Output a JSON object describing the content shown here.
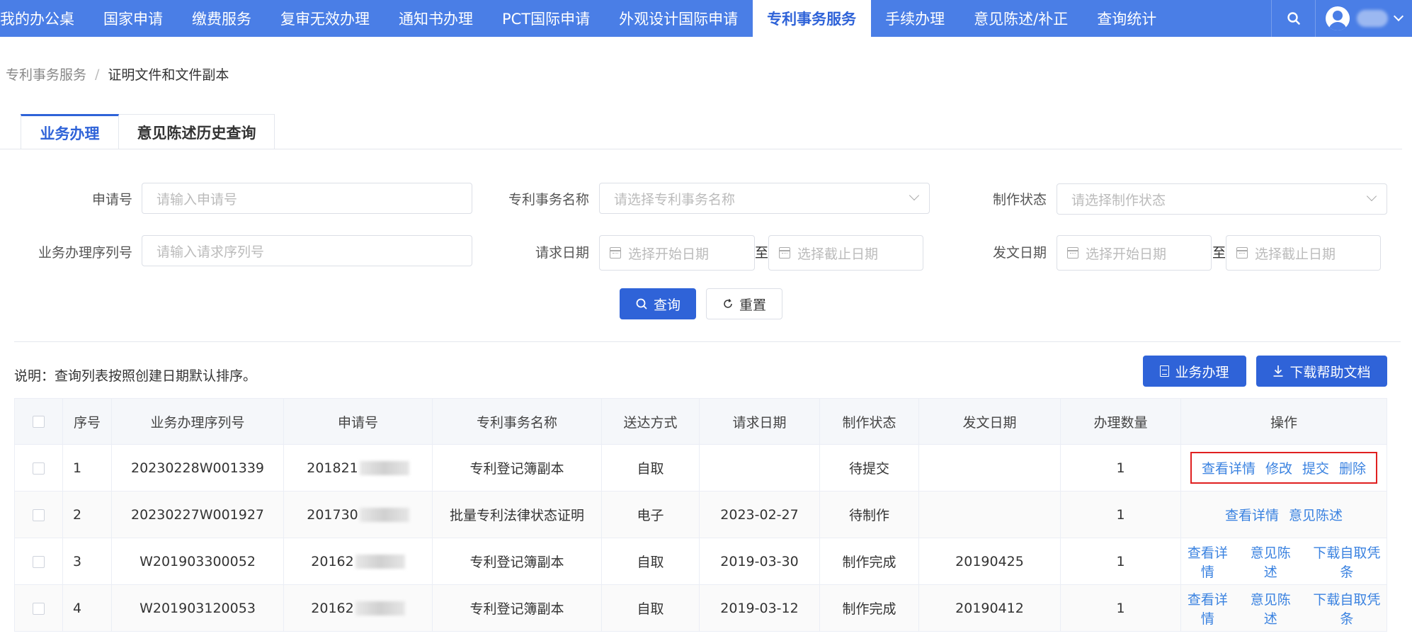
{
  "nav": {
    "items": [
      {
        "label": "我的办公桌",
        "active": false
      },
      {
        "label": "国家申请",
        "active": false
      },
      {
        "label": "缴费服务",
        "active": false
      },
      {
        "label": "复审无效办理",
        "active": false
      },
      {
        "label": "通知书办理",
        "active": false
      },
      {
        "label": "PCT国际申请",
        "active": false
      },
      {
        "label": "外观设计国际申请",
        "active": false
      },
      {
        "label": "专利事务服务",
        "active": true
      },
      {
        "label": "手续办理",
        "active": false
      },
      {
        "label": "意见陈述/补正",
        "active": false
      },
      {
        "label": "查询统计",
        "active": false
      }
    ]
  },
  "breadcrumb": {
    "parent": "专利事务服务",
    "separator": "/",
    "current": "证明文件和文件副本"
  },
  "tabs": [
    {
      "label": "业务办理",
      "active": true
    },
    {
      "label": "意见陈述历史查询",
      "active": false
    }
  ],
  "form": {
    "application_no": {
      "label": "申请号",
      "placeholder": "请输入申请号"
    },
    "affair_name": {
      "label": "专利事务名称",
      "placeholder": "请选择专利事务名称"
    },
    "status": {
      "label": "制作状态",
      "placeholder": "请选择制作状态"
    },
    "serial_no": {
      "label": "业务办理序列号",
      "placeholder": "请输入请求序列号"
    },
    "request_date": {
      "label": "请求日期",
      "start_placeholder": "选择开始日期",
      "end_placeholder": "选择截止日期",
      "to": "至"
    },
    "issue_date": {
      "label": "发文日期",
      "start_placeholder": "选择开始日期",
      "end_placeholder": "选择截止日期",
      "to": "至"
    },
    "query_label": "查询",
    "reset_label": "重置"
  },
  "note": "说明：查询列表按照创建日期默认排序。",
  "actions": {
    "handle_label": "业务办理",
    "download_label": "下载帮助文档"
  },
  "table": {
    "headers": [
      "序号",
      "业务办理序列号",
      "申请号",
      "专利事务名称",
      "送达方式",
      "请求日期",
      "制作状态",
      "发文日期",
      "办理数量",
      "操作"
    ],
    "rows": [
      {
        "no": "1",
        "serial": "20230228W001339",
        "app_no": "201821",
        "name": "专利登记簿副本",
        "delivery": "自取",
        "req_date": "",
        "status": "待提交",
        "issue_date": "",
        "qty": "1",
        "ops": [
          "查看详情",
          "修改",
          "提交",
          "删除"
        ]
      },
      {
        "no": "2",
        "serial": "20230227W001927",
        "app_no": "201730",
        "name": "批量专利法律状态证明",
        "delivery": "电子",
        "req_date": "2023-02-27",
        "status": "待制作",
        "issue_date": "",
        "qty": "1",
        "ops": [
          "查看详情",
          "意见陈述"
        ]
      },
      {
        "no": "3",
        "serial": "W201903300052",
        "app_no": "20162",
        "name": "专利登记簿副本",
        "delivery": "自取",
        "req_date": "2019-03-30",
        "status": "制作完成",
        "issue_date": "20190425",
        "qty": "1",
        "ops": [
          "查看详情",
          "意见陈述",
          "下载自取凭条"
        ]
      },
      {
        "no": "4",
        "serial": "W201903120053",
        "app_no": "20162",
        "name": "专利登记簿副本",
        "delivery": "自取",
        "req_date": "2019-03-12",
        "status": "制作完成",
        "issue_date": "20190412",
        "qty": "1",
        "ops": [
          "查看详情",
          "意见陈述",
          "下载自取凭条"
        ]
      }
    ]
  },
  "colors": {
    "nav_bg": "#4a7ee6",
    "primary": "#2f63d8",
    "link": "#3a82e0",
    "highlight_border": "#e02020"
  }
}
